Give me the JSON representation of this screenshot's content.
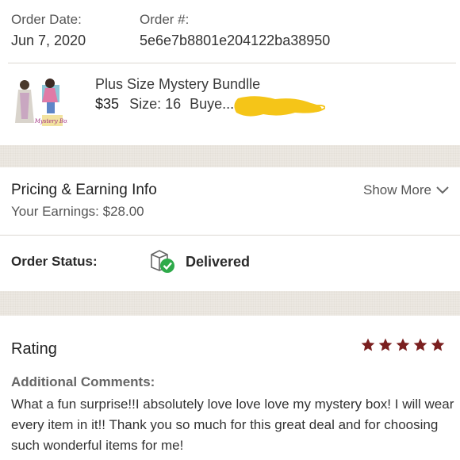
{
  "order": {
    "date_label": "Order Date:",
    "date_value": "Jun 7, 2020",
    "number_label": "Order #:",
    "number_value": "5e6e7b8801e204122ba38950"
  },
  "product": {
    "title": "Plus Size Mystery Bundlle",
    "price": "$35",
    "size": "Size: 16",
    "buyer": "Buye...",
    "thumb_caption": "Mystery Box"
  },
  "pricing": {
    "title": "Pricing & Earning Info",
    "earnings": "Your Earnings: $28.00",
    "show_more": "Show More"
  },
  "status": {
    "label": "Order Status:",
    "value": "Delivered"
  },
  "rating": {
    "title": "Rating",
    "stars": 5,
    "comments_label": "Additional Comments:",
    "comment": "What a fun surprise!!I absolutely love love love my mystery box! I will wear every item in it!! Thank you so much for this great deal and for choosing such wonderful items for me!"
  },
  "colors": {
    "star": "#7a1f1f",
    "check": "#2eaa4a",
    "redact": "#f5c518",
    "gap": "#ece8e2"
  }
}
